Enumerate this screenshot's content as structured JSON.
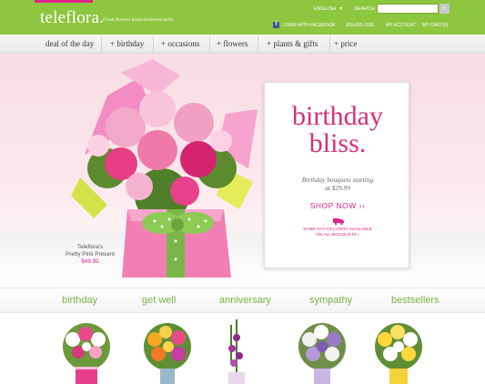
{
  "header": {
    "logo": "teleflora.",
    "tagline": "Fresh flowers hand-delivered daily.",
    "language": "ENGLISH",
    "search_label": "SEARCH",
    "search_value": "",
    "search_button": ">",
    "facebook": "LOGIN WITH FACEBOOK",
    "phone": "800-835-3356",
    "account": "MY ACCOUNT",
    "cart": "MY CART(0)"
  },
  "nav": {
    "items": [
      "deal of the day",
      "+ birthday",
      "+ occasions",
      "+ flowers",
      "+ plants & gifts",
      "+ price"
    ]
  },
  "hero": {
    "product_name_1": "Teleflora's",
    "product_name_2": "Pretty Pink Present",
    "product_price": "$49.95",
    "title_1": "birthday",
    "title_2": "bliss.",
    "subtitle_1": "Birthday bouquets starting",
    "subtitle_2": "at $29.99",
    "shop_now": "SHOP NOW ››",
    "delivery_1": "SAME-DAY DELIVERY AVAILABLE",
    "delivery_2": "ON ALL BOUQUETS ›"
  },
  "categories": {
    "items": [
      "birthday",
      "get well",
      "anniversary",
      "sympathy",
      "bestsellers"
    ]
  },
  "colors": {
    "brand_green": "#8dc63f",
    "accent_pink": "#e0258a",
    "category_green": "#7cb342"
  },
  "icons": [
    "facebook-icon",
    "truck-icon",
    "search-button-arrow"
  ]
}
